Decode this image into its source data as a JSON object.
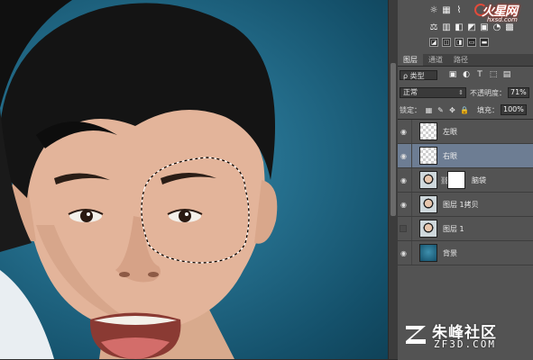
{
  "canvas": {
    "photo_description_icon": "portrait-photo",
    "selection": "marching-ants-selection"
  },
  "watermarks": {
    "top_logo": {
      "brand": "火星网",
      "site": "hxsd.com"
    },
    "bottom": {
      "cn": "朱峰社区",
      "en": "ZF3D.COM"
    }
  },
  "panel": {
    "tabs": [
      {
        "label": "图层",
        "active": true
      },
      {
        "label": "通道",
        "active": false
      },
      {
        "label": "路径",
        "active": false
      }
    ],
    "kind_label": "ρ 类型",
    "blend_mode": "正常",
    "opacity_label": "不透明度：",
    "opacity_value": "71%",
    "lock_label": "锁定：",
    "fill_label": "填充：",
    "fill_value": "100%",
    "layers": [
      {
        "name": "左眼",
        "visible": true,
        "selected": false,
        "thumb": "checker"
      },
      {
        "name": "右眼",
        "visible": true,
        "selected": true,
        "thumb": "checker"
      },
      {
        "name": "脑袋",
        "visible": true,
        "selected": false,
        "thumb": "photo",
        "has_mask": true
      },
      {
        "name": "图层 1拷贝",
        "visible": true,
        "selected": false,
        "thumb": "photo"
      },
      {
        "name": "图层 1",
        "visible": false,
        "selected": false,
        "thumb": "photo"
      },
      {
        "name": "背景",
        "visible": true,
        "selected": false,
        "thumb": "bg"
      }
    ]
  },
  "colors": {
    "panel_bg": "#535353",
    "selected_layer": "#6d7d93",
    "canvas_bg": "#256f8d"
  }
}
